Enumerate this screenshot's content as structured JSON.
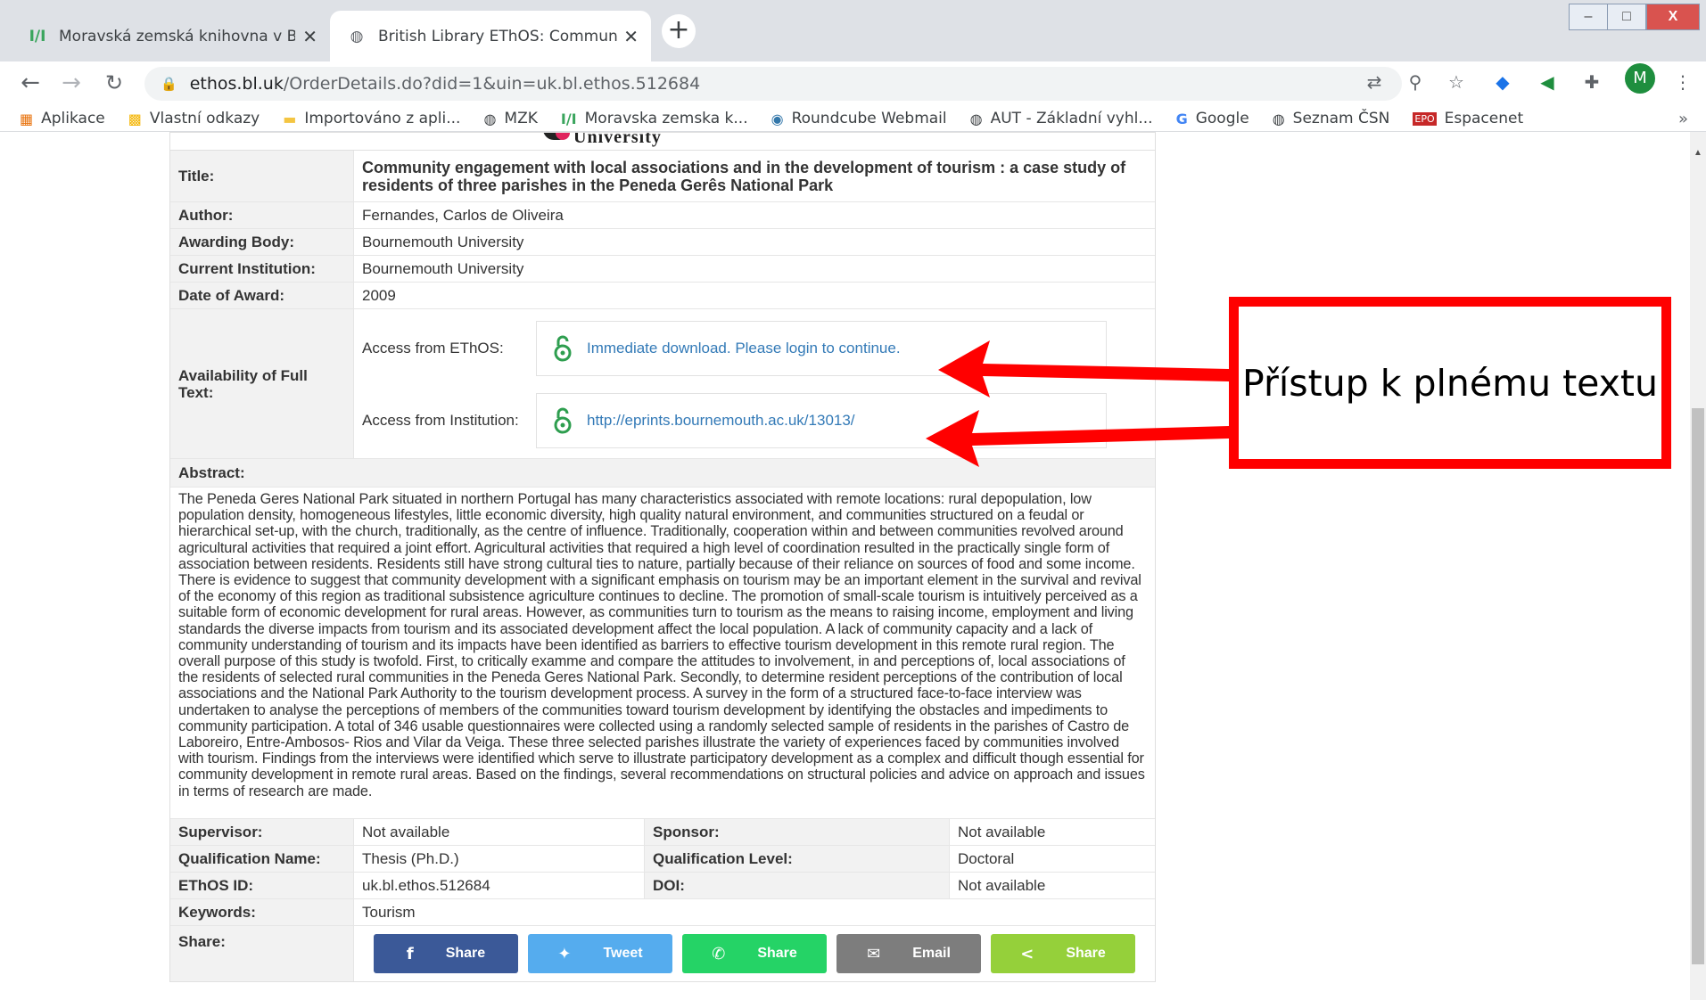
{
  "browser": {
    "tabs": [
      {
        "title": "Moravská zemská knihovna v Brn",
        "favicon": "mzk-logo-icon",
        "active": false
      },
      {
        "title": "British Library EThOS: Communit",
        "favicon": "globe-icon",
        "active": true
      }
    ],
    "new_tab": "+",
    "window_controls": {
      "minimize": "–",
      "maximize": "□",
      "close": "X"
    },
    "nav": {
      "back": "←",
      "forward": "→",
      "reload": "↻"
    },
    "address": {
      "host": "ethos.bl.uk",
      "path": "/OrderDetails.do?did=1&uin=uk.bl.ethos.512684"
    },
    "profile_initial": "M",
    "bookmarks": [
      {
        "label": "Aplikace",
        "icon": "apps-grid-icon"
      },
      {
        "label": "Vlastní odkazy",
        "icon": "windows-logo-icon"
      },
      {
        "label": "Importováno z apli...",
        "icon": "folder-icon"
      },
      {
        "label": "MZK",
        "icon": "globe-icon"
      },
      {
        "label": "Moravska zemska k...",
        "icon": "mzk-logo-icon"
      },
      {
        "label": "Roundcube Webmail",
        "icon": "roundcube-icon"
      },
      {
        "label": "AUT - Základní vyhl...",
        "icon": "globe-icon"
      },
      {
        "label": "Google",
        "icon": "google-icon"
      },
      {
        "label": "Seznam ČSN",
        "icon": "globe-icon"
      },
      {
        "label": "Espacenet",
        "icon": "epo-icon"
      }
    ],
    "bookmarks_more": "»"
  },
  "record": {
    "logo_text": "University",
    "title_label": "Title:",
    "title": "Community engagement with local associations and in the development of tourism : a case study of residents of three parishes in the Peneda Gerês National Park",
    "author_label": "Author:",
    "author": "Fernandes, Carlos de Oliveira",
    "awarding_body_label": "Awarding Body:",
    "awarding_body": "Bournemouth University",
    "current_institution_label": "Current Institution:",
    "current_institution": "Bournemouth University",
    "date_label": "Date of Award:",
    "date": "2009",
    "availability_label": "Availability of Full Text:",
    "access_ethos_label": "Access from EThOS:",
    "access_ethos_link": "Immediate download. Please login to continue.",
    "access_inst_label": "Access from Institution:",
    "access_inst_link": "http://eprints.bournemouth.ac.uk/13013/",
    "abstract_label": "Abstract:",
    "abstract": "The Peneda Geres National Park situated in northern Portugal has many characteristics associated with remote locations: rural depopulation, low population density, homogeneous lifestyles, little economic diversity, high quality natural environment, and communities structured on a feudal or hierarchical set-up, with the church, traditionally, as the centre of influence. Traditionally, cooperation within and between communities revolved around agricultural activities that required a joint effort. Agricultural activities that required a high level of coordination resulted in the practically single form of association between residents. Residents still have strong cultural ties to nature, partially because of their reliance on sources of food and some income. There is evidence to suggest that community development with a significant emphasis on tourism may be an important element in the survival and revival of the economy of this region as traditional subsistence agriculture continues to decline. The promotion of small-scale tourism is intuitively perceived as a suitable form of economic development for rural areas. However, as communities turn to tourism as the means to raising income, employment and living standards the diverse impacts from tourism and its associated development affect the local population. A lack of community capacity and a lack of community understanding of tourism and its impacts have been identified as barriers to effective tourism development in this remote rural region. The overall purpose of this study is twofold. First, to critically examme and compare the attitudes to involvement, in and perceptions of, local associations of the residents of selected rural communities in the Peneda Geres National Park. Secondly, to determine resident perceptions of the contribution of local associations and the National Park Authority to the tourism development process. A survey in the form of a structured face-to-face interview was undertaken to analyse the perceptions of members of the communities toward tourism development by identifying the obstacles and impediments to community participation. A total of 346 usable questionnaires were collected using a randomly selected sample of residents in the parishes of Castro de Laboreiro, Entre-Ambosos- Rios and Vilar da Veiga. These three selected parishes illustrate the variety of experiences faced by communities involved with tourism. Findings from the interviews were identified which serve to illustrate participatory development as a complex and difficult though essential for community development in remote rural areas. Based on the findings, several recommendations on structural policies and advice on approach and issues in terms of research are made.",
    "supervisor_label": "Supervisor:",
    "supervisor": "Not available",
    "sponsor_label": "Sponsor:",
    "sponsor": "Not available",
    "qual_name_label": "Qualification Name:",
    "qual_name": "Thesis (Ph.D.)",
    "qual_level_label": "Qualification Level:",
    "qual_level": "Doctoral",
    "ethos_id_label": "EThOS ID:",
    "ethos_id": "uk.bl.ethos.512684",
    "doi_label": "DOI:",
    "doi": "Not available",
    "keywords_label": "Keywords:",
    "keywords": "Tourism",
    "share_label": "Share:",
    "share_buttons": [
      {
        "label": "Share",
        "icon": "facebook-icon",
        "color": "#3b5998"
      },
      {
        "label": "Tweet",
        "icon": "twitter-icon",
        "color": "#55acee"
      },
      {
        "label": "Share",
        "icon": "whatsapp-icon",
        "color": "#25d366"
      },
      {
        "label": "Email",
        "icon": "email-icon",
        "color": "#7d7d7d"
      },
      {
        "label": "Share",
        "icon": "share-icon",
        "color": "#95d03a"
      }
    ]
  },
  "annotation": {
    "callout_text": "Přístup k plnému textu",
    "color": "#ff0000"
  }
}
